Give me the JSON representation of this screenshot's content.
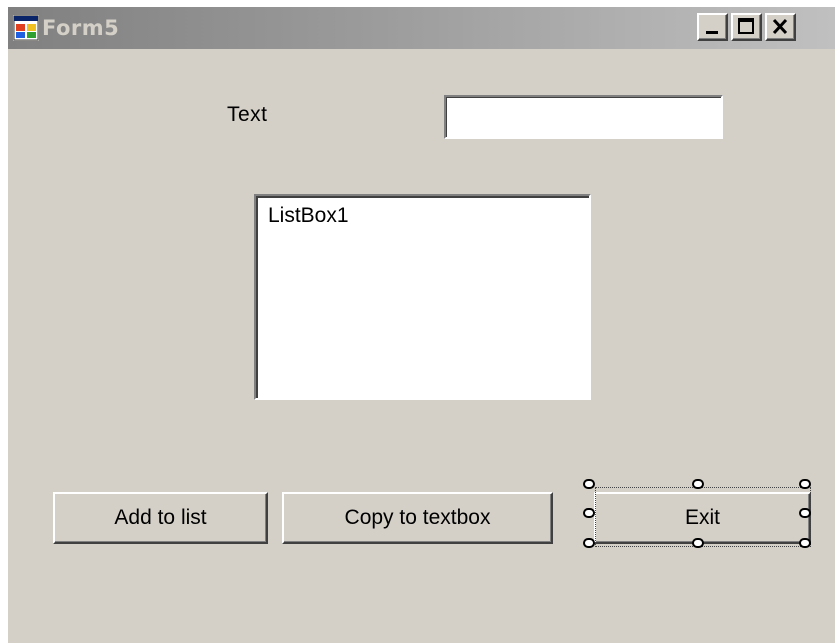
{
  "window": {
    "title": "Form5",
    "app_icon": "form-icon",
    "controls": {
      "minimize_icon": "minimize-icon",
      "maximize_icon": "maximize-icon",
      "close_icon": "close-icon"
    }
  },
  "form": {
    "text_label": "Text",
    "text_value": "",
    "listbox_items": [
      "ListBox1"
    ],
    "buttons": {
      "add": "Add to list",
      "copy": "Copy to textbox",
      "exit": "Exit"
    }
  },
  "colors": {
    "face": "#d4d0c8",
    "title_inactive_start": "#808080",
    "title_inactive_end": "#c0c0c0"
  }
}
